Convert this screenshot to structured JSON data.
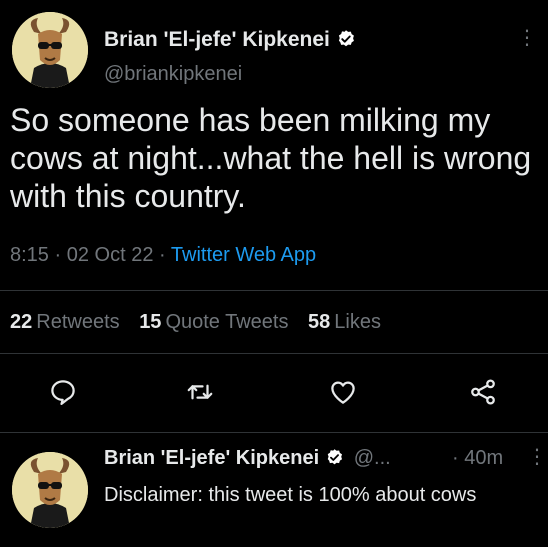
{
  "tweet": {
    "author": {
      "name": "Brian 'El-jefe' Kipkenei",
      "handle": "@briankipkenei",
      "avatar_icon": "goat-with-sunglasses-avatar",
      "verified_icon": "verified-badge-icon"
    },
    "text": "So someone has been milking my cows at night...what the hell is wrong with this country.",
    "time": "8:15",
    "sep": "·",
    "date": "02 Oct 22",
    "source": "Twitter Web App",
    "stats": {
      "retweets_count": "22",
      "retweets_label": "Retweets",
      "quotes_count": "15",
      "quotes_label": "Quote Tweets",
      "likes_count": "58",
      "likes_label": "Likes"
    },
    "actions": [
      "reply-icon",
      "retweet-icon",
      "like-icon",
      "share-icon"
    ]
  },
  "reply": {
    "author_name": "Brian 'El-jefe' Kipkenei",
    "handle": "@...",
    "time": "· 40m",
    "text": "Disclaimer: this tweet is 100% about cows"
  },
  "colors": {
    "background": "#000000",
    "text": "#e7e9ea",
    "muted": "#71767b",
    "link": "#1d9bf0",
    "verified": "#ffffff"
  }
}
